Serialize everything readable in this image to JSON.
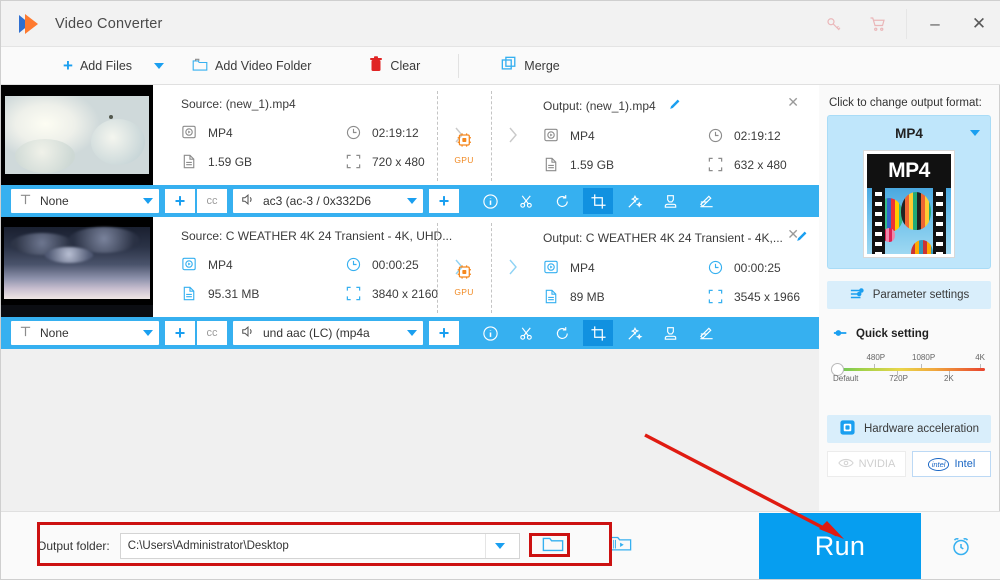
{
  "window": {
    "title": "Video Converter",
    "key_icon": "key-icon",
    "cart_icon": "cart-icon",
    "minimize": "–",
    "close": "✕"
  },
  "toolbar": {
    "add_files": "Add Files",
    "add_files_caret": "chevron-down-icon",
    "add_video_folder": "Add Video Folder",
    "clear": "Clear",
    "merge": "Merge"
  },
  "files": [
    {
      "source_label": "Source: (new_1).mp4",
      "source_format": "MP4",
      "source_duration": "02:19:12",
      "source_size": "1.59 GB",
      "source_resolution": "720 x 480",
      "gpu_label": "GPU",
      "output_label": "Output: (new_1).mp4",
      "output_format": "MP4",
      "output_duration": "02:19:12",
      "output_size": "1.59 GB",
      "output_resolution": "632 x 480",
      "subtitle_value": "None",
      "audio_value": "ac3 (ac-3 / 0x332D6",
      "cc_label": "cc",
      "icon_state": "gray"
    },
    {
      "source_label": "Source: C  WEATHER  4K 24  Transient - 4K, UHD...",
      "source_format": "MP4",
      "source_duration": "00:00:25",
      "source_size": "95.31 MB",
      "source_resolution": "3840 x 2160",
      "gpu_label": "GPU",
      "output_label": "Output: C  WEATHER  4K 24  Transient - 4K,...",
      "output_format": "MP4",
      "output_duration": "00:00:25",
      "output_size": "89 MB",
      "output_resolution": "3545 x 1966",
      "subtitle_value": "None",
      "audio_value": "und aac (LC) (mp4a",
      "cc_label": "cc",
      "icon_state": "blue"
    }
  ],
  "strip_icons": [
    {
      "name": "info-icon",
      "active": false
    },
    {
      "name": "cut-icon",
      "active": false
    },
    {
      "name": "rotate-icon",
      "active": false
    },
    {
      "name": "crop-icon",
      "active": true
    },
    {
      "name": "effect-icon",
      "active": false
    },
    {
      "name": "watermark-icon",
      "active": false
    },
    {
      "name": "subtitle-icon",
      "active": false
    }
  ],
  "right_panel": {
    "prompt": "Click to change output format:",
    "format_name": "MP4",
    "format_thumb_text": "MP4",
    "parameter_settings": "Parameter settings",
    "quick_setting": "Quick setting",
    "slider": {
      "top_labels": [
        "480P",
        "1080P",
        "4K"
      ],
      "bottom_labels": [
        "Default",
        "720P",
        "2K"
      ],
      "value": "Default"
    },
    "hardware_acceleration": "Hardware acceleration",
    "gpu_options": [
      {
        "label": "NVIDIA",
        "enabled": false
      },
      {
        "label": "Intel",
        "enabled": true
      }
    ]
  },
  "bottom": {
    "output_folder_label": "Output folder:",
    "output_folder_value": "C:\\Users\\Administrator\\Desktop",
    "browse_icon": "folder-icon",
    "preview_icon": "film-folder-icon",
    "run_label": "Run",
    "alarm_icon": "alarm-clock-icon"
  },
  "annotations": {
    "highlight_color": "#cc1111",
    "arrow_color": "#e01b11"
  }
}
